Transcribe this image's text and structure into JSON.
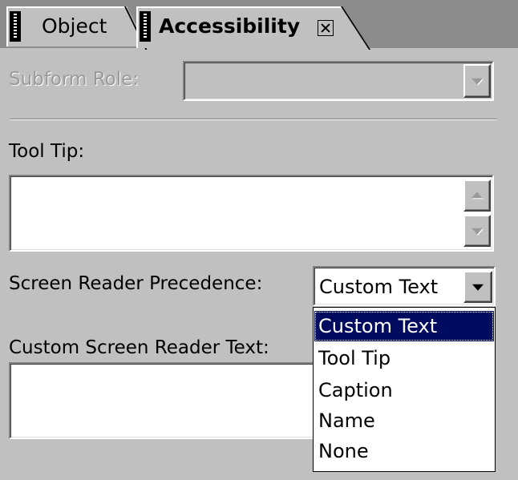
{
  "tabs": [
    {
      "label": "Object",
      "active": false
    },
    {
      "label": "Accessibility",
      "active": true
    }
  ],
  "icons": {
    "grip": "grip-icon",
    "close": "close-icon",
    "dropdown_arrow": "chevron-down-icon",
    "scroll_up": "arrow-up-icon",
    "scroll_down": "arrow-down-icon"
  },
  "form": {
    "subform_role": {
      "label": "Subform Role:",
      "value": "",
      "enabled": false
    },
    "tool_tip": {
      "label": "Tool Tip:",
      "value": ""
    },
    "screen_reader_precedence": {
      "label": "Screen Reader Precedence:",
      "value": "Custom Text",
      "options": [
        "Custom Text",
        "Tool Tip",
        "Caption",
        "Name",
        "None"
      ],
      "highlighted_option": "Custom Text"
    },
    "custom_screen_reader_text": {
      "label": "Custom Screen Reader Text:",
      "value": ""
    }
  },
  "colors": {
    "panel": "#c0c0c0",
    "selection": "#000a5e",
    "disabled_text": "#9a9a9a"
  }
}
